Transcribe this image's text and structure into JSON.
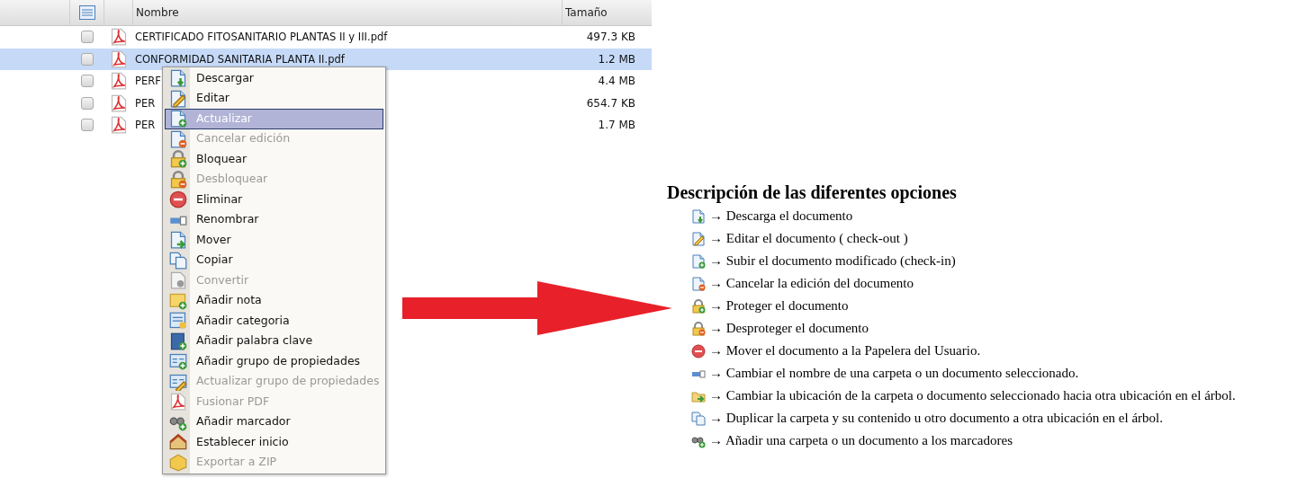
{
  "table": {
    "columns": [
      "Nombre",
      "Tamaño"
    ],
    "rows": [
      {
        "name": "CERTIFICADO FITOSANITARIO PLANTAS II y III.pdf",
        "size": "497.3 KB",
        "checked": false,
        "selected": false
      },
      {
        "name": "CONFORMIDAD SANITARIA PLANTA II.pdf",
        "size": "1.2 MB",
        "checked": false,
        "selected": true
      },
      {
        "name": "PERF",
        "size": "4.4 MB",
        "checked": false,
        "selected": false
      },
      {
        "name": "PER",
        "size": "654.7 KB",
        "checked": false,
        "selected": false
      },
      {
        "name": "PER",
        "size": "1.7 MB",
        "checked": false,
        "selected": false
      }
    ]
  },
  "context_menu": [
    {
      "label": "Descargar",
      "selected": false,
      "disabled": false
    },
    {
      "label": "Editar",
      "selected": false,
      "disabled": false
    },
    {
      "label": "Actualizar",
      "selected": true,
      "disabled": false
    },
    {
      "label": "Cancelar edición",
      "selected": false,
      "disabled": true
    },
    {
      "label": "Bloquear",
      "selected": false,
      "disabled": false
    },
    {
      "label": "Desbloquear",
      "selected": false,
      "disabled": true
    },
    {
      "label": "Eliminar",
      "selected": false,
      "disabled": false
    },
    {
      "label": "Renombrar",
      "selected": false,
      "disabled": false
    },
    {
      "label": "Mover",
      "selected": false,
      "disabled": false
    },
    {
      "label": "Copiar",
      "selected": false,
      "disabled": false
    },
    {
      "label": "Convertir",
      "selected": false,
      "disabled": true
    },
    {
      "label": "Añadir nota",
      "selected": false,
      "disabled": false
    },
    {
      "label": "Añadir categoria",
      "selected": false,
      "disabled": false
    },
    {
      "label": "Añadir palabra clave",
      "selected": false,
      "disabled": false
    },
    {
      "label": "Añadir grupo de propiedades",
      "selected": false,
      "disabled": false
    },
    {
      "label": "Actualizar grupo de propiedades",
      "selected": false,
      "disabled": true
    },
    {
      "label": "Fusionar PDF",
      "selected": false,
      "disabled": true
    },
    {
      "label": "Añadir marcador",
      "selected": false,
      "disabled": false
    },
    {
      "label": "Establecer inicio",
      "selected": false,
      "disabled": false
    },
    {
      "label": "Exportar a ZIP",
      "selected": false,
      "disabled": true
    }
  ],
  "description": {
    "title": "Descripción de las diferentes opciones",
    "items": [
      "→ Descarga el documento",
      "→ Editar el documento ( check-out )",
      "→ Subir el documento modificado (check-in)",
      "→ Cancelar la edición del documento",
      "→ Proteger el documento",
      "→ Desproteger el documento",
      "→ Mover el documento a la Papelera del Usuario.",
      "→ Cambiar el nombre de una carpeta o un documento seleccionado.",
      "→ Cambiar la ubicación de la carpeta o documento seleccionado hacia otra ubicación en el árbol.",
      "→ Duplicar la carpeta y su contenido u otro documento a otra ubicación en el árbol.",
      "→ Añadir una carpeta o un documento a los marcadores"
    ]
  }
}
